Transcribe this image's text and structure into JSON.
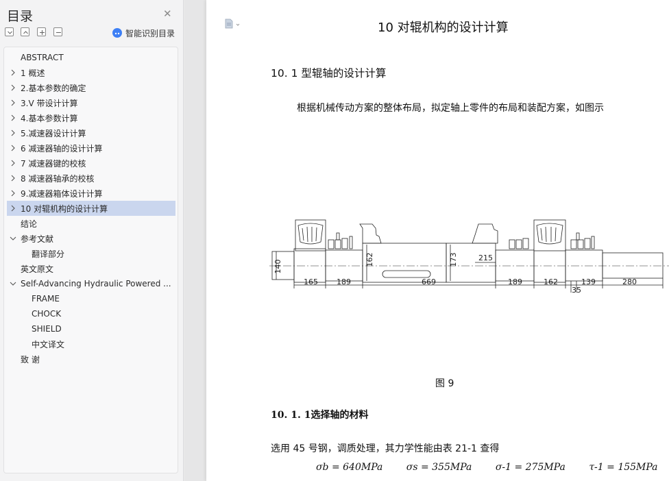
{
  "sidebar": {
    "title": "目录",
    "ai_toc_label": "智能识别目录",
    "items": [
      {
        "label": "ABSTRACT",
        "level": 0,
        "arrow": "none"
      },
      {
        "label": "1  概述",
        "level": 0,
        "arrow": "collapsed"
      },
      {
        "label": "2.基本参数的确定",
        "level": 0,
        "arrow": "collapsed"
      },
      {
        "label": "3.V 带设计计算",
        "level": 0,
        "arrow": "collapsed"
      },
      {
        "label": "4.基本参数计算",
        "level": 0,
        "arrow": "collapsed"
      },
      {
        "label": "5.减速器设计计算",
        "level": 0,
        "arrow": "collapsed"
      },
      {
        "label": "6  减速器轴的设计计算",
        "level": 0,
        "arrow": "collapsed"
      },
      {
        "label": "7  减速器键的校核",
        "level": 0,
        "arrow": "collapsed"
      },
      {
        "label": "8  减速器轴承的校核",
        "level": 0,
        "arrow": "collapsed"
      },
      {
        "label": "9.减速器箱体设计计算",
        "level": 0,
        "arrow": "collapsed"
      },
      {
        "label": "10  对辊机构的设计计算",
        "level": 0,
        "arrow": "collapsed",
        "active": true
      },
      {
        "label": "结论",
        "level": 0,
        "arrow": "none"
      },
      {
        "label": "参考文献",
        "level": 0,
        "arrow": "expanded"
      },
      {
        "label": "翻译部分",
        "level": 1,
        "arrow": "none"
      },
      {
        "label": "英文原文",
        "level": 0,
        "arrow": "none"
      },
      {
        "label": "Self-Advancing Hydraulic Powered ...",
        "level": 0,
        "arrow": "expanded"
      },
      {
        "label": "FRAME",
        "level": 1,
        "arrow": "none"
      },
      {
        "label": "CHOCK",
        "level": 1,
        "arrow": "none"
      },
      {
        "label": "SHIELD",
        "level": 1,
        "arrow": "none"
      },
      {
        "label": "中文译文",
        "level": 1,
        "arrow": "none"
      },
      {
        "label": "致      谢",
        "level": 0,
        "arrow": "none"
      }
    ]
  },
  "document": {
    "chapter_title": "10  对辊机构的设计计算",
    "section_title": "10. 1 型辊轴的设计计算",
    "paragraph1": "根据机械传动方案的整体布局，拟定轴上零件的布局和装配方案，如图示",
    "figure_caption": "图    9",
    "subsection_title": "10. 1. 1选择轴的材料",
    "paragraph2": "选用 45 号钢，调质处理，其力学性能由表 21-1 查得",
    "formula": {
      "sb": "σb = 640MPa",
      "ss": "σs = 355MPa",
      "sm1": "σ-1 = 275MPa",
      "tm1": "τ-1 = 155MPa"
    },
    "dimensions": {
      "d140": "140",
      "d162a": "162",
      "d173": "173",
      "d215": "215",
      "l165": "165",
      "l189a": "189",
      "l669": "669",
      "l189b": "189",
      "l162b": "162",
      "l139": "139",
      "l280": "280",
      "l35": "35"
    }
  },
  "colors": {
    "active_item_bg": "#cad6ee",
    "ai_icon": "#3d7ff5"
  }
}
